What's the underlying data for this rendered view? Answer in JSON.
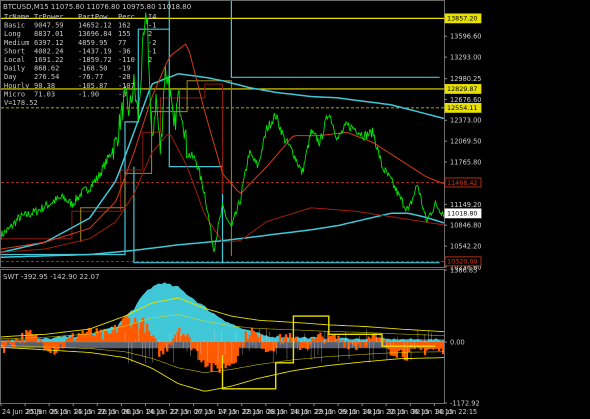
{
  "main": {
    "title": "BTCUSD,M15  11075.80 11076.80 10975.80 11018.80",
    "table": {
      "headers": [
        "TrName",
        "TrPower",
        "PartPow",
        "Perc",
        "I4"
      ],
      "rows": [
        [
          "Basic",
          "9047.59",
          "14652.12",
          "162",
          "-1"
        ],
        [
          "Long",
          "8837.01",
          "13696.84",
          "155",
          "2"
        ],
        [
          "Medium",
          "6397.12",
          "4859.95",
          "77",
          "-2"
        ],
        [
          "Short",
          "4002.24",
          "-1437.19",
          "-36",
          "-1"
        ],
        [
          "Local",
          "1691.22",
          "-1859.72",
          "-110",
          "2"
        ],
        [
          "Daily",
          "868.62",
          "-168.50",
          "-19",
          ""
        ],
        [
          "Day",
          "276.54",
          "-76.77",
          "-28",
          ""
        ],
        [
          "Hourly",
          "98.38",
          "-105.87",
          "-107",
          ""
        ],
        [
          "Micro",
          "71.03",
          "-1.90",
          "-3",
          ""
        ]
      ],
      "footer": "V=178.52"
    }
  },
  "sub": {
    "title": "SWT -392.95 -142.90 22.07"
  },
  "colors": {
    "background": "#000000",
    "price": "#00e600",
    "cyan": "#40c8d8",
    "dark_red": "#8b1a0a",
    "red": "#d23c1c",
    "yellow": "#e8e000",
    "orange": "#ff5a00",
    "olive": "#a08a20",
    "grid": "#2a2a2a"
  },
  "chart_data": [
    {
      "type": "line",
      "title": "BTCUSD,M15",
      "ylim": [
        10238.0,
        14110.0
      ],
      "y_ticks": [
        "13596.60",
        "13293.00",
        "12980.25",
        "12676.60",
        "12373.00",
        "12069.50",
        "11765.80",
        "11149.20",
        "10846.80",
        "10542.20",
        "10238.60"
      ],
      "x_ticks": [
        "24 Jun 2019",
        "25 Jun 06:15",
        "25 Jun 14:15",
        "25 Jun 22:15",
        "26 Jun 06:15",
        "26 Jun 14:15",
        "26 Jun 22:15",
        "27 Jun 06:15",
        "27 Jun 14:15",
        "27 Jun 22:15",
        "28 Jun 06:15",
        "28 Jun 14:15",
        "28 Jun 22:15",
        "29 Jun 06:15",
        "29 Jun 14:15",
        "29 Jun 22:15",
        "30 Jun 06:15",
        "30 Jun 14:15",
        "30 Jun 22:15"
      ],
      "price_labels": [
        {
          "value": "13857.20",
          "color": "#e8e000"
        },
        {
          "value": "12829.87",
          "color": "#e8e000"
        },
        {
          "value": "12554.11",
          "color": "#e8e000"
        },
        {
          "value": "11468.42",
          "color": "#d23c1c"
        },
        {
          "value": "11018.80",
          "color": "#ffffff"
        },
        {
          "value": "10320.00",
          "color": "#d23c1c"
        }
      ],
      "levels": [
        {
          "value": 13857.2,
          "color": "#e8e000",
          "style": "solid",
          "from": 0.0
        },
        {
          "value": 12829.87,
          "color": "#e8e000",
          "style": "solid",
          "from": 0.0
        },
        {
          "value": 12554.11,
          "color": "#e8e000",
          "style": "dashed",
          "from": 0.0
        },
        {
          "value": 11468.42,
          "color": "#d23c1c",
          "style": "dashed",
          "from": 0.0
        },
        {
          "value": 10320.0,
          "color": "#d23c1c",
          "style": "dashed",
          "from": 0.0
        }
      ],
      "series": [
        {
          "id": "price",
          "color": "#00e600",
          "t": [
            0.0,
            0.02,
            0.04,
            0.06,
            0.08,
            0.1,
            0.12,
            0.14,
            0.16,
            0.18,
            0.2,
            0.22,
            0.24,
            0.26,
            0.27,
            0.28,
            0.29,
            0.3,
            0.31,
            0.32,
            0.33,
            0.34,
            0.35,
            0.36,
            0.37,
            0.38,
            0.39,
            0.4,
            0.41,
            0.42,
            0.44,
            0.46,
            0.48,
            0.5,
            0.52,
            0.54,
            0.56,
            0.58,
            0.6,
            0.62,
            0.64,
            0.66,
            0.68,
            0.7,
            0.72,
            0.74,
            0.76,
            0.78,
            0.8,
            0.82,
            0.84,
            0.86,
            0.88,
            0.9,
            0.92,
            0.94,
            0.96,
            0.98,
            1.0
          ],
          "values": [
            10700,
            10800,
            10950,
            11000,
            11050,
            11120,
            11200,
            11250,
            11150,
            11300,
            11400,
            11550,
            11800,
            12050,
            12400,
            12700,
            12500,
            12900,
            12400,
            13400,
            13950,
            12000,
            12700,
            11900,
            13100,
            12900,
            12200,
            12700,
            12500,
            11900,
            11800,
            11300,
            10500,
            11100,
            10800,
            11200,
            11900,
            11700,
            12250,
            12450,
            12100,
            11900,
            11600,
            12200,
            12050,
            12500,
            12100,
            12300,
            12250,
            12150,
            12200,
            11700,
            11500,
            11250,
            11050,
            11450,
            10900,
            11150,
            11018
          ]
        },
        {
          "id": "cyan_line",
          "color": "#40c8d8",
          "t": [
            0.0,
            0.1,
            0.2,
            0.26,
            0.3,
            0.34,
            0.4,
            0.46,
            0.5,
            0.56,
            0.62,
            0.7,
            0.76,
            0.82,
            0.88,
            0.94,
            1.0
          ],
          "values": [
            10450,
            10600,
            10950,
            11500,
            12200,
            12900,
            13050,
            13000,
            12950,
            12850,
            12780,
            12720,
            12700,
            12650,
            12600,
            12500,
            12400
          ]
        },
        {
          "id": "cyan_line_lower",
          "color": "#40c8d8",
          "t": [
            0.0,
            0.2,
            0.3,
            0.4,
            0.5,
            0.6,
            0.7,
            0.76,
            0.8,
            0.84,
            0.88,
            0.92,
            0.96,
            1.0
          ],
          "values": [
            10380,
            10420,
            10480,
            10560,
            10620,
            10700,
            10780,
            10840,
            10900,
            10960,
            11020,
            11020,
            10960,
            10880
          ]
        },
        {
          "id": "red_ma",
          "color": "#d23c1c",
          "t": [
            0.0,
            0.1,
            0.2,
            0.26,
            0.3,
            0.34,
            0.38,
            0.42,
            0.46,
            0.5,
            0.54,
            0.6,
            0.66,
            0.72,
            0.78,
            0.84,
            0.9,
            0.96,
            1.0
          ],
          "values": [
            10500,
            10600,
            10800,
            11200,
            11900,
            12700,
            13300,
            13500,
            12500,
            11600,
            11300,
            11700,
            12150,
            12150,
            12200,
            12050,
            11800,
            11550,
            11450
          ]
        },
        {
          "id": "red_channel_lower",
          "color": "#a01e0a",
          "t": [
            0.0,
            0.1,
            0.2,
            0.26,
            0.3,
            0.34,
            0.38,
            0.42,
            0.46,
            0.5,
            0.54,
            0.6,
            0.7,
            0.8,
            0.9,
            1.0
          ],
          "values": [
            10450,
            10500,
            10650,
            10900,
            11300,
            11900,
            12200,
            11700,
            11000,
            10600,
            10620,
            10900,
            11100,
            11050,
            10950,
            10850
          ]
        }
      ]
    },
    {
      "type": "area",
      "title": "SWT",
      "ylim": [
        -1172.92,
        1386.85
      ],
      "y_ticks": [
        "1386.85",
        "0.00",
        "-1172.92"
      ],
      "series": [
        {
          "id": "cyan_area",
          "color": "#40c8d8",
          "t": [
            0.0,
            0.1,
            0.2,
            0.26,
            0.3,
            0.33,
            0.36,
            0.4,
            0.44,
            0.48,
            0.52,
            0.56,
            0.6,
            0.7,
            0.8,
            0.9,
            1.0
          ],
          "values": [
            20,
            60,
            150,
            300,
            650,
            1000,
            1150,
            1050,
            800,
            550,
            350,
            200,
            120,
            80,
            60,
            50,
            40
          ]
        },
        {
          "id": "orange_area",
          "color": "#ff5a00",
          "t": [
            0.0,
            0.06,
            0.12,
            0.18,
            0.24,
            0.28,
            0.32,
            0.36,
            0.4,
            0.44,
            0.48,
            0.52,
            0.56,
            0.6,
            0.64,
            0.68,
            0.72,
            0.76,
            0.8,
            0.84,
            0.88,
            0.92,
            0.96,
            1.0
          ],
          "values": [
            -100,
            150,
            -150,
            200,
            100,
            450,
            350,
            -250,
            300,
            -200,
            -550,
            -380,
            250,
            -150,
            120,
            -100,
            100,
            50,
            -60,
            80,
            -150,
            -250,
            -120,
            -200
          ]
        },
        {
          "id": "yellow_band_upper",
          "color": "#e8e000",
          "t": [
            0.0,
            0.1,
            0.2,
            0.28,
            0.34,
            0.4,
            0.46,
            0.52,
            0.58,
            0.66,
            0.74,
            0.82,
            0.9,
            1.0
          ],
          "values": [
            100,
            150,
            250,
            500,
            750,
            850,
            650,
            500,
            420,
            380,
            330,
            300,
            250,
            200
          ]
        },
        {
          "id": "yellow_band_lower",
          "color": "#e8e000",
          "t": [
            0.0,
            0.1,
            0.2,
            0.28,
            0.34,
            0.4,
            0.46,
            0.52,
            0.58,
            0.66,
            0.74,
            0.82,
            0.9,
            1.0
          ],
          "values": [
            -100,
            -150,
            -200,
            -300,
            -500,
            -800,
            -950,
            -850,
            -700,
            -550,
            -450,
            -380,
            -320,
            -300
          ]
        }
      ]
    }
  ]
}
